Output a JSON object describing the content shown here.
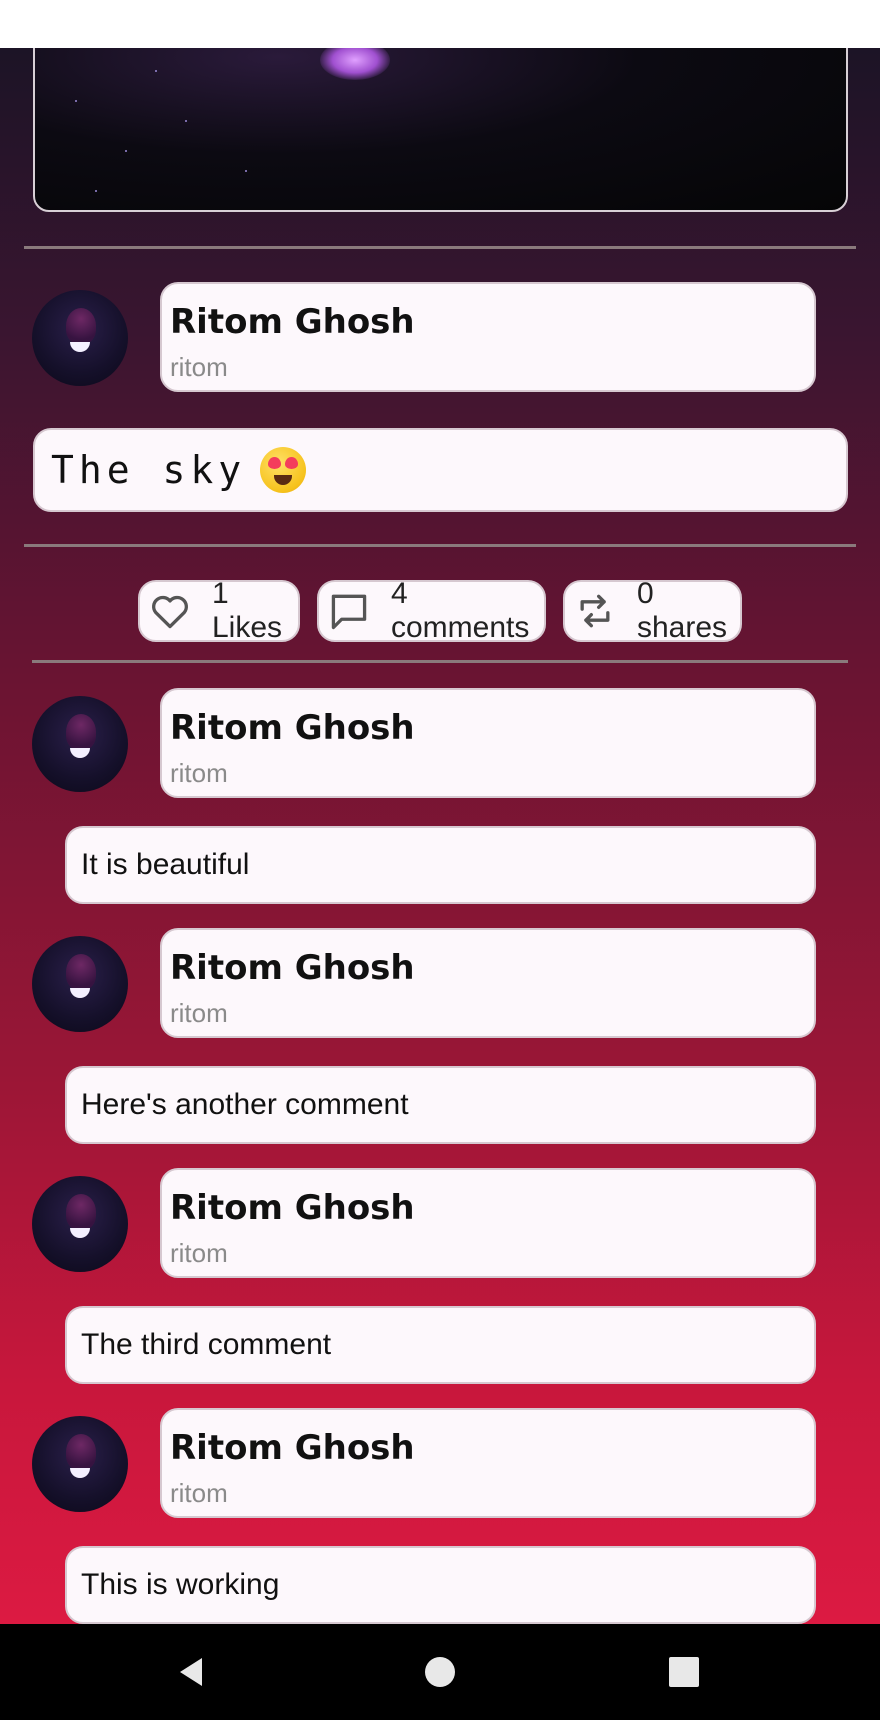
{
  "post": {
    "author_name": "Ritom Ghosh",
    "author_handle": "ritom",
    "caption": "The sky"
  },
  "stats": {
    "likes": "1 Likes",
    "comments": "4 comments",
    "shares": "0 shares"
  },
  "comments": [
    {
      "author_name": "Ritom Ghosh",
      "author_handle": "ritom",
      "text": "It is beautiful"
    },
    {
      "author_name": "Ritom Ghosh",
      "author_handle": "ritom",
      "text": "Here's another comment"
    },
    {
      "author_name": "Ritom Ghosh",
      "author_handle": "ritom",
      "text": "The third comment"
    },
    {
      "author_name": "Ritom Ghosh",
      "author_handle": "ritom",
      "text": "This is working"
    }
  ],
  "icons": {
    "likes": "heart-icon",
    "comments": "comment-icon",
    "shares": "repost-icon",
    "nav_back": "back-triangle-icon",
    "nav_home": "home-circle-icon",
    "nav_recents": "recents-square-icon"
  },
  "colors": {
    "gradient_top": "#1c1426",
    "gradient_bottom": "#dc1a42",
    "card_bg": "#fdf8fc"
  }
}
